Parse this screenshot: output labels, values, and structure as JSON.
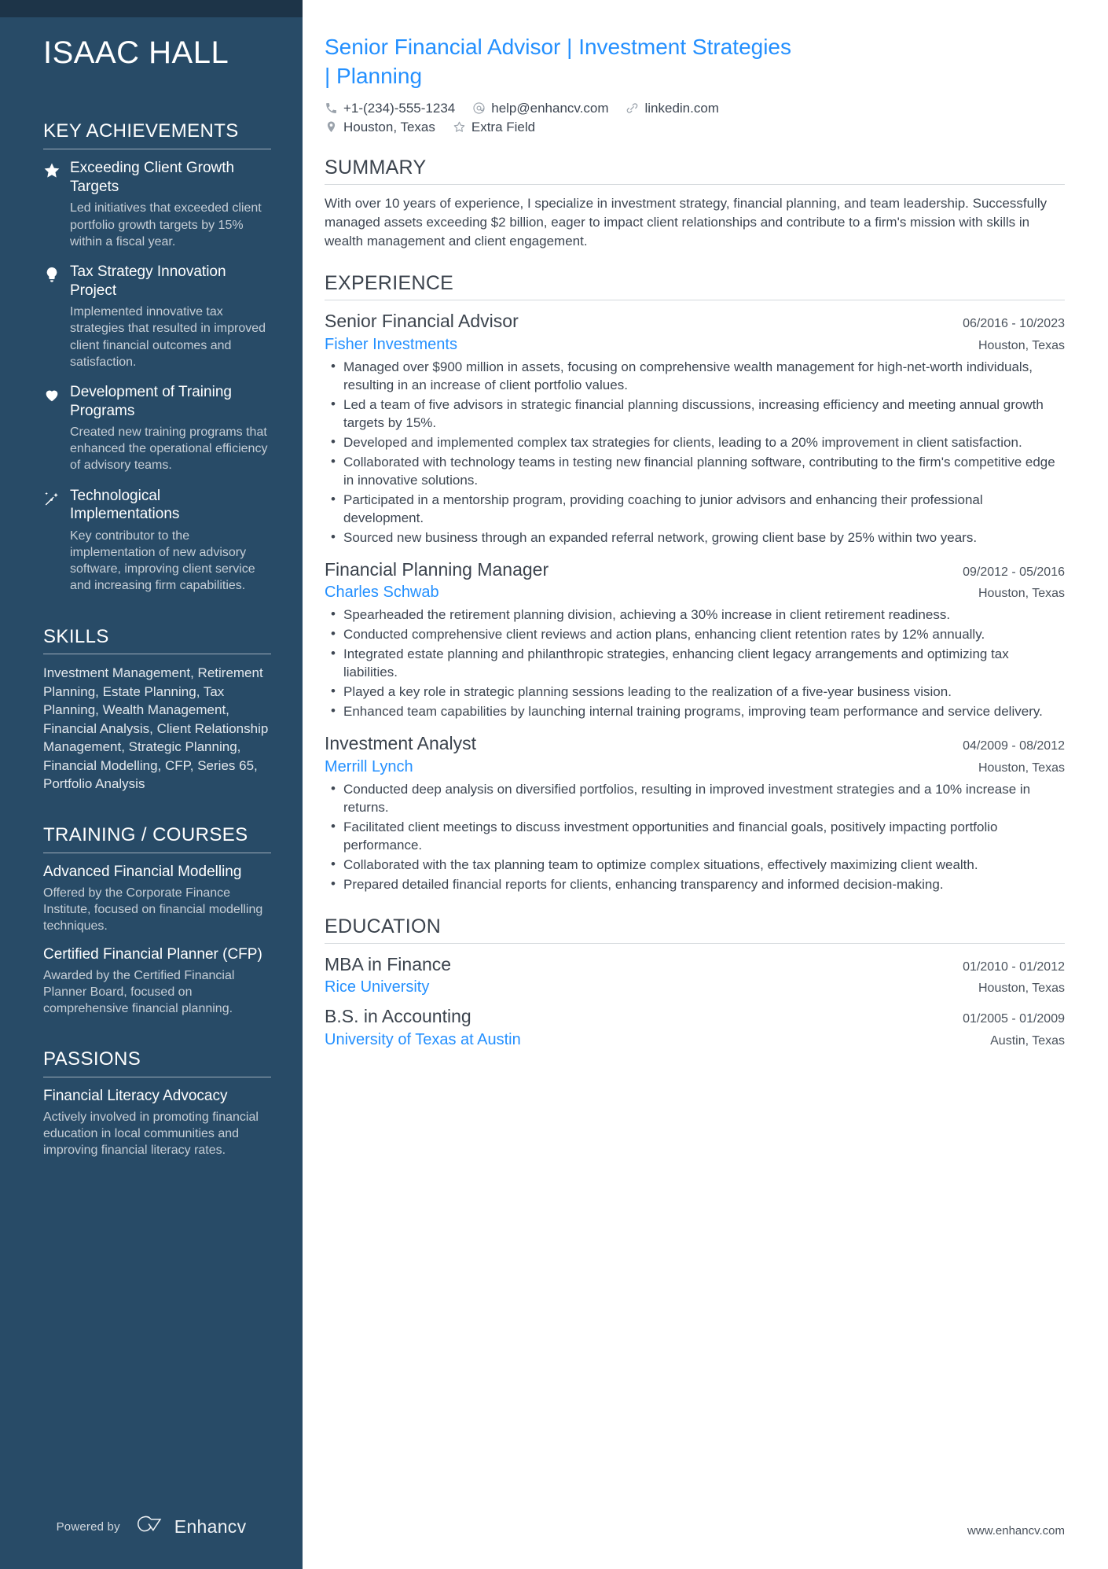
{
  "theme": {
    "sidebar_bg": "#284b67",
    "sidebar_topbar_bg": "#1d3448",
    "accent_blue": "#2490ff",
    "body_text": "#3d4652"
  },
  "sidebar": {
    "name": "ISAAC HALL",
    "sections": {
      "key_achievements": {
        "title": "KEY ACHIEVEMENTS",
        "items": [
          {
            "icon": "star-icon",
            "title": "Exceeding Client Growth Targets",
            "description": "Led initiatives that exceeded client portfolio growth targets by 15% within a fiscal year."
          },
          {
            "icon": "lightbulb-icon",
            "title": "Tax Strategy Innovation Project",
            "description": "Implemented innovative tax strategies that resulted in improved client financial outcomes and satisfaction."
          },
          {
            "icon": "heart-icon",
            "title": "Development of Training Programs",
            "description": "Created new training programs that enhanced the operational efficiency of advisory teams."
          },
          {
            "icon": "magic-wand-icon",
            "title": "Technological Implementations",
            "description": "Key contributor to the implementation of new advisory software, improving client service and increasing firm capabilities."
          }
        ]
      },
      "skills": {
        "title": "SKILLS",
        "text": "Investment Management, Retirement Planning, Estate Planning, Tax Planning, Wealth Management, Financial Analysis, Client Relationship Management, Strategic Planning, Financial Modelling, CFP, Series 65, Portfolio Analysis"
      },
      "training": {
        "title": "TRAINING / COURSES",
        "items": [
          {
            "title": "Advanced Financial Modelling",
            "description": "Offered by the Corporate Finance Institute, focused on financial modelling techniques."
          },
          {
            "title": "Certified Financial Planner (CFP)",
            "description": "Awarded by the Certified Financial Planner Board, focused on comprehensive financial planning."
          }
        ]
      },
      "passions": {
        "title": "PASSIONS",
        "items": [
          {
            "title": "Financial Literacy Advocacy",
            "description": "Actively involved in promoting financial education in local communities and improving financial literacy rates."
          }
        ]
      }
    },
    "footer": {
      "powered_by": "Powered by",
      "brand": "Enhancv"
    }
  },
  "main": {
    "headline": "Senior Financial Advisor | Investment Strategies | Planning",
    "contact": {
      "row1": [
        {
          "icon": "phone-icon",
          "value": "+1-(234)-555-1234"
        },
        {
          "icon": "email-icon",
          "value": "help@enhancv.com"
        },
        {
          "icon": "link-icon",
          "value": "linkedin.com"
        }
      ],
      "row2": [
        {
          "icon": "location-pin-icon",
          "value": "Houston, Texas"
        },
        {
          "icon": "star-outline-icon",
          "value": "Extra Field"
        }
      ]
    },
    "summary": {
      "title": "SUMMARY",
      "text": "With over 10 years of experience, I specialize in investment strategy, financial planning, and team leadership. Successfully managed assets exceeding $2 billion, eager to impact client relationships and contribute to a firm's mission with skills in wealth management and client engagement."
    },
    "experience": {
      "title": "EXPERIENCE",
      "entries": [
        {
          "role": "Senior Financial Advisor",
          "date": "06/2016 - 10/2023",
          "company": "Fisher Investments",
          "location": "Houston, Texas",
          "bullets": [
            "Managed over $900 million in assets, focusing on comprehensive wealth management for high-net-worth individuals, resulting in an increase of client portfolio values.",
            "Led a team of five advisors in strategic financial planning discussions, increasing efficiency and meeting annual growth targets by 15%.",
            "Developed and implemented complex tax strategies for clients, leading to a 20% improvement in client satisfaction.",
            "Collaborated with technology teams in testing new financial planning software, contributing to the firm's competitive edge in innovative solutions.",
            "Participated in a mentorship program, providing coaching to junior advisors and enhancing their professional development.",
            "Sourced new business through an expanded referral network, growing client base by 25% within two years."
          ]
        },
        {
          "role": "Financial Planning Manager",
          "date": "09/2012 - 05/2016",
          "company": "Charles Schwab",
          "location": "Houston, Texas",
          "bullets": [
            "Spearheaded the retirement planning division, achieving a 30% increase in client retirement readiness.",
            "Conducted comprehensive client reviews and action plans, enhancing client retention rates by 12% annually.",
            "Integrated estate planning and philanthropic strategies, enhancing client legacy arrangements and optimizing tax liabilities.",
            "Played a key role in strategic planning sessions leading to the realization of a five-year business vision.",
            "Enhanced team capabilities by launching internal training programs, improving team performance and service delivery."
          ]
        },
        {
          "role": "Investment Analyst",
          "date": "04/2009 - 08/2012",
          "company": "Merrill Lynch",
          "location": "Houston, Texas",
          "bullets": [
            "Conducted deep analysis on diversified portfolios, resulting in improved investment strategies and a 10% increase in returns.",
            "Facilitated client meetings to discuss investment opportunities and financial goals, positively impacting portfolio performance.",
            "Collaborated with the tax planning team to optimize complex situations, effectively maximizing client wealth.",
            "Prepared detailed financial reports for clients, enhancing transparency and informed decision-making."
          ]
        }
      ]
    },
    "education": {
      "title": "EDUCATION",
      "entries": [
        {
          "degree": "MBA in Finance",
          "date": "01/2010 - 01/2012",
          "school": "Rice University",
          "location": "Houston, Texas"
        },
        {
          "degree": "B.S. in Accounting",
          "date": "01/2005 - 01/2009",
          "school": "University of Texas at Austin",
          "location": "Austin, Texas"
        }
      ]
    },
    "footer_url": "www.enhancv.com"
  }
}
